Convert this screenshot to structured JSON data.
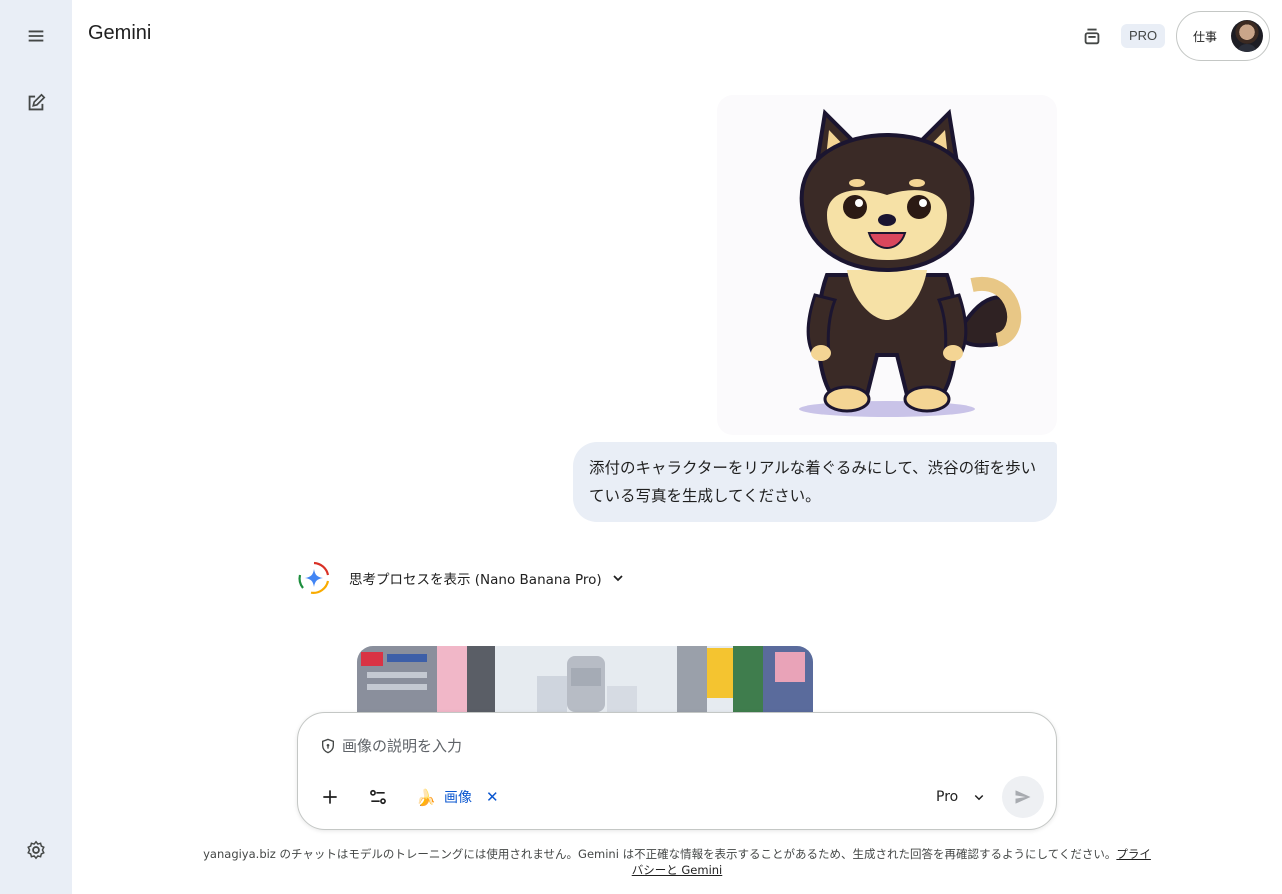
{
  "header": {
    "title": "Gemini",
    "pro_badge": "PRO",
    "account_label": "仕事"
  },
  "conversation": {
    "user_message": "添付のキャラクターをリアルな着ぐるみにして、渋谷の街を歩いている写真を生成してください。",
    "thought_label": "思考プロセスを表示 (Nano Banana Pro)"
  },
  "composer": {
    "placeholder": "画像の説明を入力",
    "tool_label": "画像",
    "tool_close": "✕",
    "model_label": "Pro"
  },
  "footer": {
    "disclaimer": "yanagiya.biz のチャットはモデルのトレーニングには使用されません。Gemini は不正確な情報を表示することがあるため、生成された回答を再確認するようにしてください。",
    "privacy_link": "プライバシーと Gemini"
  },
  "icons": {
    "menu": "menu-icon",
    "new_chat": "edit-icon",
    "settings": "gear-icon",
    "temp_chat": "temporary-chat-icon",
    "add": "plus-icon",
    "tools": "tune-icon",
    "send": "send-icon"
  },
  "colors": {
    "sidebar": "#e9eef6",
    "accent": "#0b57d0",
    "bubble": "#e9eef6"
  }
}
